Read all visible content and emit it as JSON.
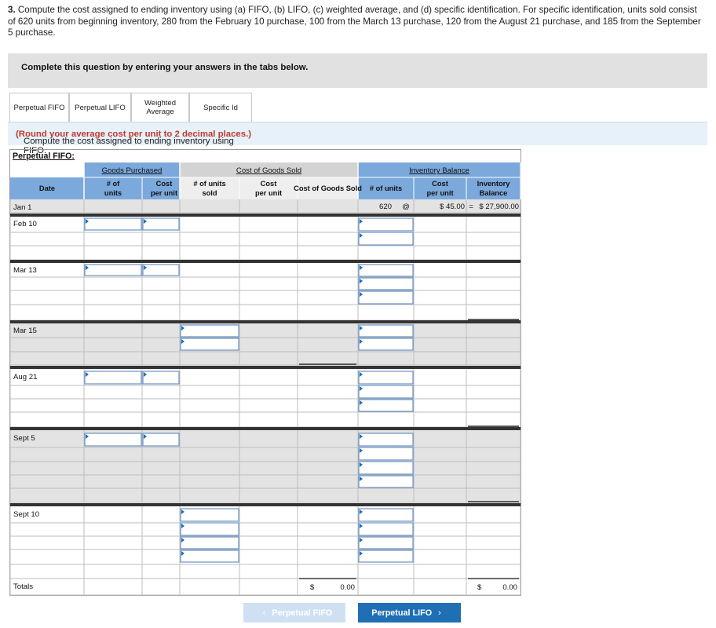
{
  "question": {
    "number": "3.",
    "text": "Compute the cost assigned to ending inventory using (a) FIFO, (b) LIFO, (c) weighted average, and (d) specific identification. For specific identification, units sold consist of 620 units from beginning inventory, 280 from the February 10 purchase, 100 from the March 13 purchase, 120 from the August 21 purchase, and 185 from the September 5 purchase."
  },
  "banner": "Complete this question by entering your answers in the tabs below.",
  "tabs": [
    {
      "label": "Perpetual FIFO",
      "active": true
    },
    {
      "label": "Perpetual LIFO",
      "active": false
    },
    {
      "label": "Weighted Average",
      "active": false
    },
    {
      "label": "Specific Id",
      "active": false
    }
  ],
  "instruction": {
    "text": "Compute the cost assigned to ending inventory using FIFO.",
    "note": "(Round your average cost per unit to 2 decimal places.)"
  },
  "table": {
    "title": "Perpetual FIFO:",
    "group_headers": {
      "purchased": "Goods Purchased",
      "cogs": "Cost of Goods Sold",
      "balance": "Inventory Balance"
    },
    "column_headers": {
      "date": "Date",
      "gp_units": "# of units",
      "gp_cost": "Cost per unit",
      "cogs_units": "# of units sold",
      "cogs_cost": "Cost per unit",
      "cogs_total": "Cost of Goods Sold",
      "ib_units": "# of units",
      "ib_cost": "Cost per unit",
      "ib_total": "Inventory Balance"
    },
    "dates": [
      "Jan 1",
      "Feb 10",
      "Mar 13",
      "Mar 15",
      "Aug 21",
      "Sept 5",
      "Sept 10",
      "Totals"
    ],
    "jan1": {
      "units": "620",
      "at": "@",
      "cost": "$ 45.00",
      "equals": "=",
      "balance": "$ 27,900.00"
    },
    "totals": {
      "cogs_symbol": "$",
      "cogs_value": "0.00",
      "balance_symbol": "$",
      "balance_value": "0.00"
    }
  },
  "nav": {
    "prev": "Perpetual FIFO",
    "next": "Perpetual LIFO"
  },
  "colors": {
    "header_blue": "#7ba9dc",
    "header_gray": "#d3d3d3",
    "shaded_row": "#e3e3e3",
    "input_border": "#6a93c4",
    "separator": "#333333",
    "instruction_note": "#c0392b",
    "next_button": "#1f6fb5",
    "prev_button_disabled": "#cfe0f3"
  }
}
